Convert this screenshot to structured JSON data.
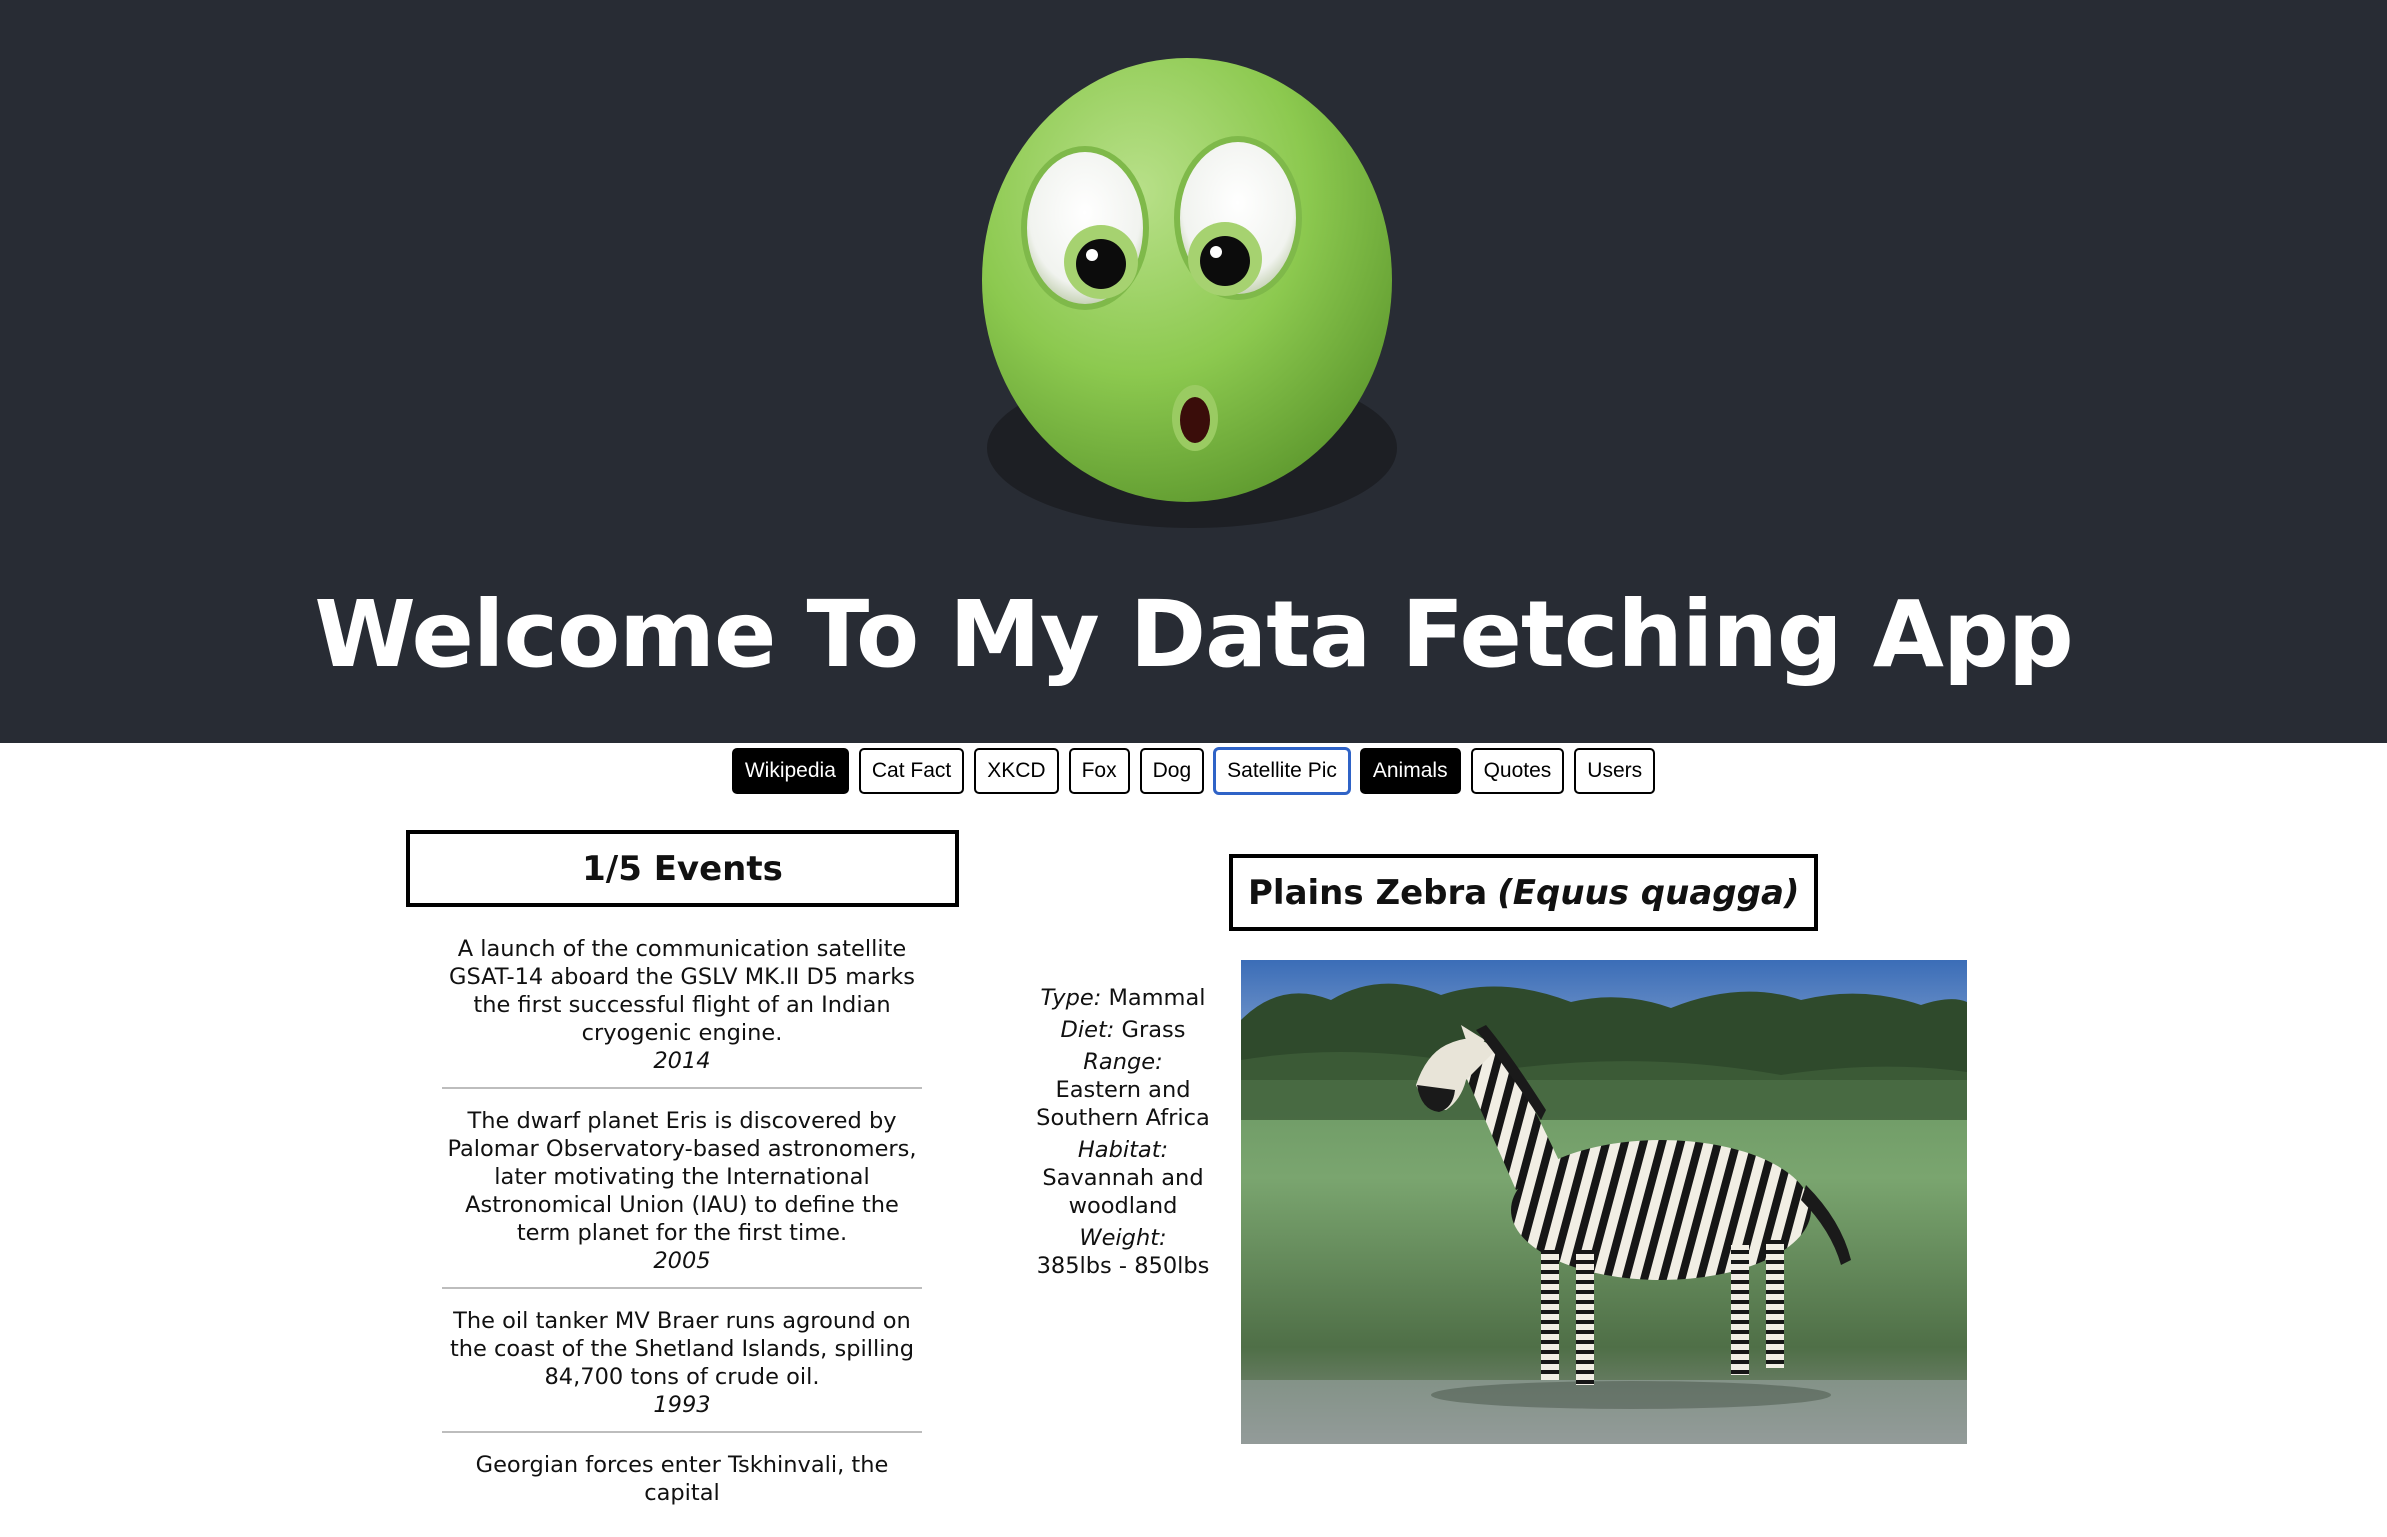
{
  "header": {
    "title": "Welcome To My Data Fetching App",
    "background_color": "#282c34",
    "logo_icon": "green-surprised-face-icon"
  },
  "nav": {
    "buttons": [
      {
        "label": "Wikipedia",
        "state": "active"
      },
      {
        "label": "Cat Fact",
        "state": "normal"
      },
      {
        "label": "XKCD",
        "state": "normal"
      },
      {
        "label": "Fox",
        "state": "normal"
      },
      {
        "label": "Dog",
        "state": "normal"
      },
      {
        "label": "Satellite Pic",
        "state": "focused"
      },
      {
        "label": "Animals",
        "state": "active"
      },
      {
        "label": "Quotes",
        "state": "normal"
      },
      {
        "label": "Users",
        "state": "normal"
      }
    ]
  },
  "events": {
    "title": "1/5 Events",
    "items": [
      {
        "text": "A launch of the communication satellite GSAT-14 aboard the GSLV MK.II D5 marks the first successful flight of an Indian cryogenic engine.",
        "year": "2014"
      },
      {
        "text": "The dwarf planet Eris is discovered by Palomar Observatory-based astronomers, later motivating the International Astronomical Union (IAU) to define the term planet for the first time.",
        "year": "2005"
      },
      {
        "text": "The oil tanker MV Braer runs aground on the coast of the Shetland Islands, spilling 84,700 tons of crude oil.",
        "year": "1993"
      },
      {
        "text": "Georgian forces enter Tskhinvali, the capital",
        "year": ""
      }
    ]
  },
  "animal": {
    "name": "Plains Zebra",
    "scientific_name": "(Equus quagga)",
    "facts": {
      "type_label": "Type:",
      "type_value": "Mammal",
      "diet_label": "Diet:",
      "diet_value": "Grass",
      "range_label": "Range:",
      "range_value": "Eastern and Southern Africa",
      "habitat_label": "Habitat:",
      "habitat_value": "Savannah and woodland",
      "weight_label": "Weight:",
      "weight_value": "385lbs - 850lbs"
    },
    "image_icon": "zebra-photo"
  }
}
